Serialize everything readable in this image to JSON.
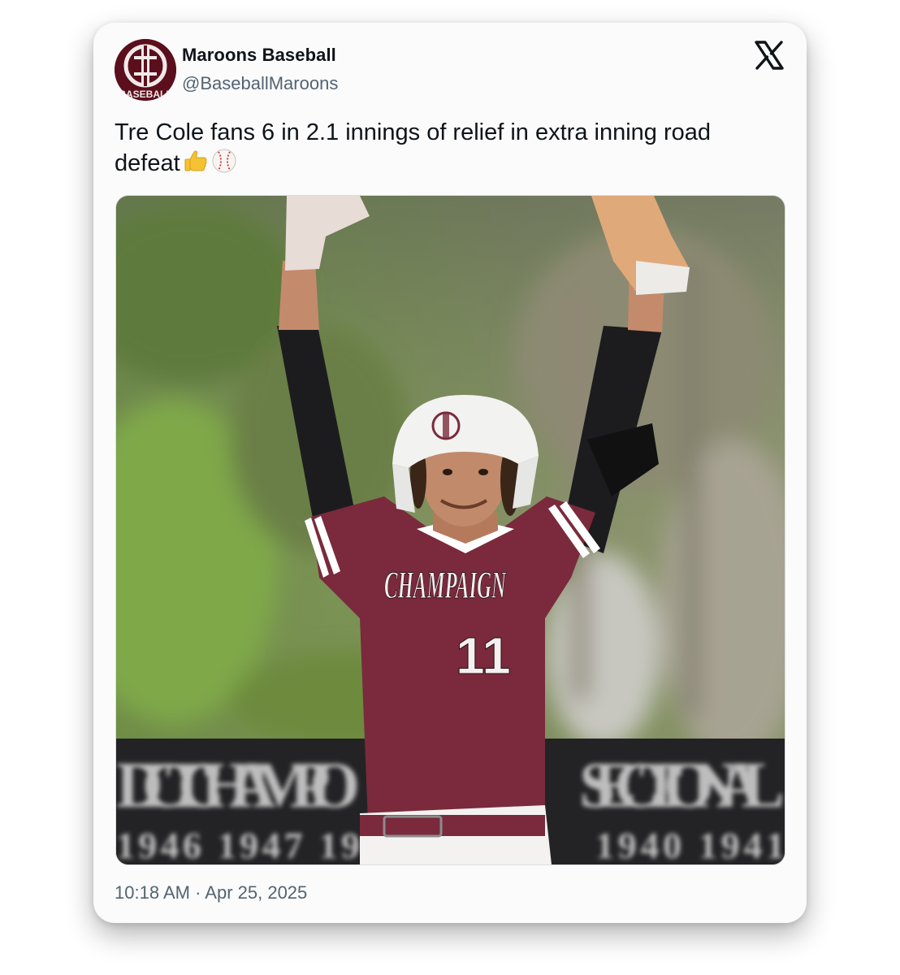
{
  "post": {
    "author": {
      "display_name": "Maroons Baseball",
      "handle": "@BaseballMaroons",
      "avatar_text": "BASEBALL"
    },
    "text": "Tre Cole fans 6 in 2.1 innings of relief in extra inning road defeat",
    "emojis": [
      "thumbs-up-icon",
      "baseball-icon"
    ],
    "timestamp": "10:18 AM · Apr 25, 2025",
    "platform_icon": "x-logo-icon"
  },
  "photo": {
    "jersey_text": "CHAMPAIGN",
    "jersey_number": "11",
    "wall_text_left": "DICT CHAMPIO",
    "wall_text_right": "SECTIONAL",
    "wall_years_left": "1946 1947 19",
    "wall_years_right": "1940 1941",
    "colors": {
      "maroon": "#7a2a3c",
      "helmet": "#f2f2f0",
      "sleeve": "#1c1c1e",
      "foliage": "#6f8a4f"
    }
  }
}
